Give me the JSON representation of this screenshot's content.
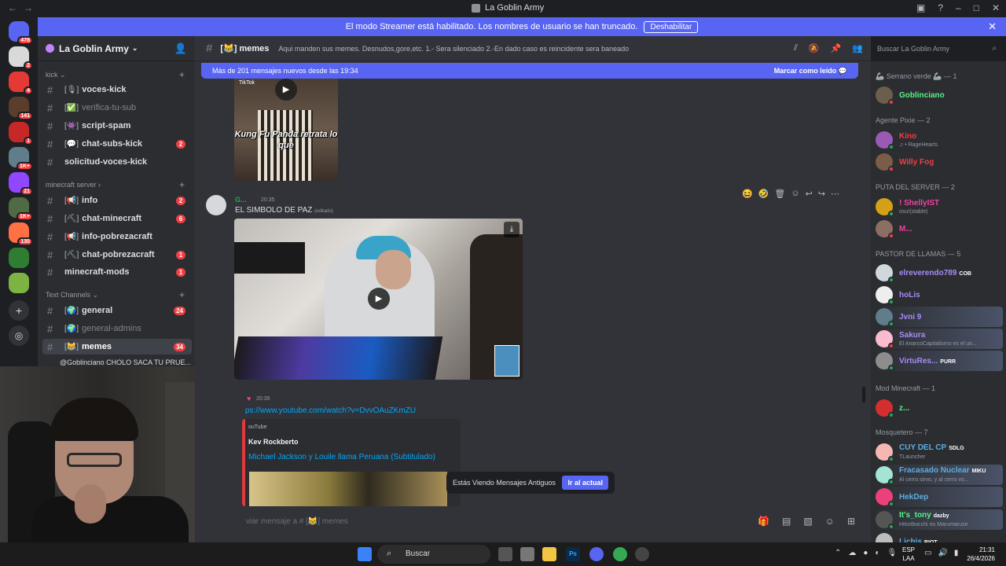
{
  "window": {
    "title": "La Goblin Army"
  },
  "banner": {
    "text": "El modo Streamer está habilitado. Los nombres de usuario se han truncado.",
    "button": "Deshabilitar"
  },
  "servers": [
    {
      "badge": "478",
      "color": "#5865f2"
    },
    {
      "badge": "2",
      "color": "#d9d9d9"
    },
    {
      "badge": "4",
      "color": "#e53935"
    },
    {
      "badge": "141",
      "color": "#5a3d2b"
    },
    {
      "badge": "1",
      "color": "#c62828"
    },
    {
      "badge": "1K+",
      "color": "#607d8b"
    },
    {
      "badge": "21",
      "color": "#9146ff"
    },
    {
      "badge": "1K+",
      "color": "#4e6b43"
    },
    {
      "badge": "130",
      "color": "#ff7043"
    },
    {
      "badge": "",
      "color": "#2e7d32"
    },
    {
      "badge": "",
      "color": "#7cb342"
    }
  ],
  "sidebar": {
    "guild_name": "La Goblin Army",
    "categories": [
      {
        "label": "kick"
      },
      {
        "label": "minecraft server"
      },
      {
        "label": "Text Channels"
      }
    ],
    "channels": [
      {
        "emoji": "[🎙]",
        "name": "voces-kick",
        "muted": false,
        "count": ""
      },
      {
        "emoji": "[✅]",
        "name": "verifica-tu-sub",
        "muted": true,
        "count": ""
      },
      {
        "emoji": "[👾]",
        "name": "script-spam",
        "muted": false,
        "count": ""
      },
      {
        "emoji": "[💬]",
        "name": "chat-subs-kick",
        "muted": false,
        "count": "2"
      },
      {
        "emoji": "",
        "name": "solicitud-voces-kick",
        "muted": false,
        "count": ""
      },
      {
        "emoji": "[📢]",
        "name": "info",
        "muted": false,
        "count": "2"
      },
      {
        "emoji": "[⛏]",
        "name": "chat-minecraft",
        "muted": false,
        "count": "6"
      },
      {
        "emoji": "[📢]",
        "name": "info-pobrezacraft",
        "muted": false,
        "count": ""
      },
      {
        "emoji": "[⛏]",
        "name": "chat-pobrezacraft",
        "muted": false,
        "count": "1"
      },
      {
        "emoji": "",
        "name": "minecraft-mods",
        "muted": false,
        "count": "1"
      },
      {
        "emoji": "[🌍]",
        "name": "general",
        "muted": false,
        "count": "24"
      },
      {
        "emoji": "[🌍]",
        "name": "general-admins",
        "muted": true,
        "count": ""
      },
      {
        "emoji": "[😹]",
        "name": "memes",
        "muted": false,
        "count": "34",
        "selected": true
      }
    ],
    "thread": "@Goblinciano CHOLO SACA TU PRUE..."
  },
  "topbar": {
    "channel": "memes",
    "channel_emoji": "[😹]",
    "topic": "Aqui manden sus memes. Desnudos,gore,etc. 1.- Sera silenciado 2.-En dado caso es reincidente sera baneado",
    "search_placeholder": "Buscar La Goblin Army"
  },
  "new_messages": {
    "text": "Más de 201 mensajes nuevos desde las 19:34",
    "mark": "Marcar como leído"
  },
  "tiktok": {
    "brand": "TikTok",
    "caption": "Kung Fu Panda retrata lo que"
  },
  "message1": {
    "author": "G...",
    "time": "20:35",
    "text": "EL SIMBOLO DE PAZ",
    "edited": "(editado)"
  },
  "message2": {
    "time": "20:35",
    "link": "ps://www.youtube.com/watch?v=DvvOAuZKmZU",
    "embed_provider": "ouTube",
    "embed_author": "Kev Rockberto",
    "embed_title": "Michael Jackson y Louile llama Peruana (Subtitulado)"
  },
  "old_messages": {
    "text": "Estás Viendo Mensajes Antiguos",
    "jump": "Ir al actual"
  },
  "composer": {
    "placeholder": "viar mensaje a # [😹] memes"
  },
  "members": {
    "groups": [
      {
        "title": "🦾 Serrano verde 🦾 — 1"
      },
      {
        "title": "Agente Pixie — 2"
      },
      {
        "title": "PUTA DEL SERVER — 2"
      },
      {
        "title": "PASTOR DE LLAMAS — 5"
      },
      {
        "title": "Mod Minecraft — 1"
      },
      {
        "title": "Mosquetero — 7"
      }
    ],
    "list": [
      {
        "name": "Goblinciano",
        "sub": "",
        "tag": "",
        "color": "#57f287",
        "av": "#6b5e4a",
        "status": "#f23f43"
      },
      {
        "name": "Kino",
        "sub": "♫ • RageHearts",
        "tag": "",
        "color": "#f23f43",
        "av": "#9b59b6",
        "status": "#23a55a"
      },
      {
        "name": "Willy Fog",
        "sub": "",
        "tag": "",
        "color": "#f23f43",
        "av": "#7a5c48",
        "status": "#f23f43"
      },
      {
        "name": "! ShellyIST",
        "sub": "osu!(stable)",
        "tag": "",
        "color": "#eb459e",
        "av": "#d4a017",
        "status": "#23a55a"
      },
      {
        "name": "M...",
        "sub": "",
        "tag": "",
        "color": "#eb459e",
        "av": "#8d6e63",
        "status": "#f23f43"
      },
      {
        "name": "elreverendo789",
        "sub": "",
        "tag": "COB",
        "color": "#a78bfa",
        "av": "#cfd8dc",
        "status": "#23a55a"
      },
      {
        "name": "hoLis",
        "sub": "",
        "tag": "",
        "color": "#a78bfa",
        "av": "#eeeeee",
        "status": "#23a55a"
      },
      {
        "name": "Jvni 9",
        "sub": "",
        "tag": "",
        "color": "#a78bfa",
        "av": "#607d8b",
        "status": "#23a55a"
      },
      {
        "name": "Sakura",
        "sub": "El AnarcoCapitalismo es el un...",
        "tag": "",
        "color": "#a78bfa",
        "av": "#f8bbd0",
        "status": "#f23f43"
      },
      {
        "name": "VirtuRes...",
        "sub": "",
        "tag": "PURR",
        "color": "#a78bfa",
        "av": "#8d8d8d",
        "status": "#23a55a"
      },
      {
        "name": "z...",
        "sub": "",
        "tag": "",
        "color": "#57f287",
        "av": "#d32f2f",
        "status": "#23a55a"
      },
      {
        "name": "CUY DEL CP",
        "sub": "TLauncher",
        "tag": "SDLG",
        "color": "#5dade2",
        "av": "#f5b7b1",
        "status": "#23a55a"
      },
      {
        "name": "Fracasado Nuclear",
        "sub": "Al cerro sirvo, y al cerro vo...",
        "tag": "MIKU",
        "color": "#5dade2",
        "av": "#a3e4d7",
        "status": "#23a55a"
      },
      {
        "name": "HekDep",
        "sub": "",
        "tag": "",
        "color": "#5dade2",
        "av": "#ec407a",
        "status": "#23a55a"
      },
      {
        "name": "It's_tony",
        "sub": "Hitoribocchi no Marumaruse",
        "tag": "dazby",
        "color": "#57f287",
        "av": "#555",
        "status": "#23a55a"
      },
      {
        "name": "Lichis",
        "sub": "",
        "tag": "RIOT",
        "color": "#5dade2",
        "av": "#bdbdbd",
        "status": "#23a55a"
      }
    ]
  },
  "taskbar": {
    "search": "Buscar",
    "lang1": "ESP",
    "lang2": "LAA",
    "time": "21:31",
    "date": "26/4/2026"
  }
}
